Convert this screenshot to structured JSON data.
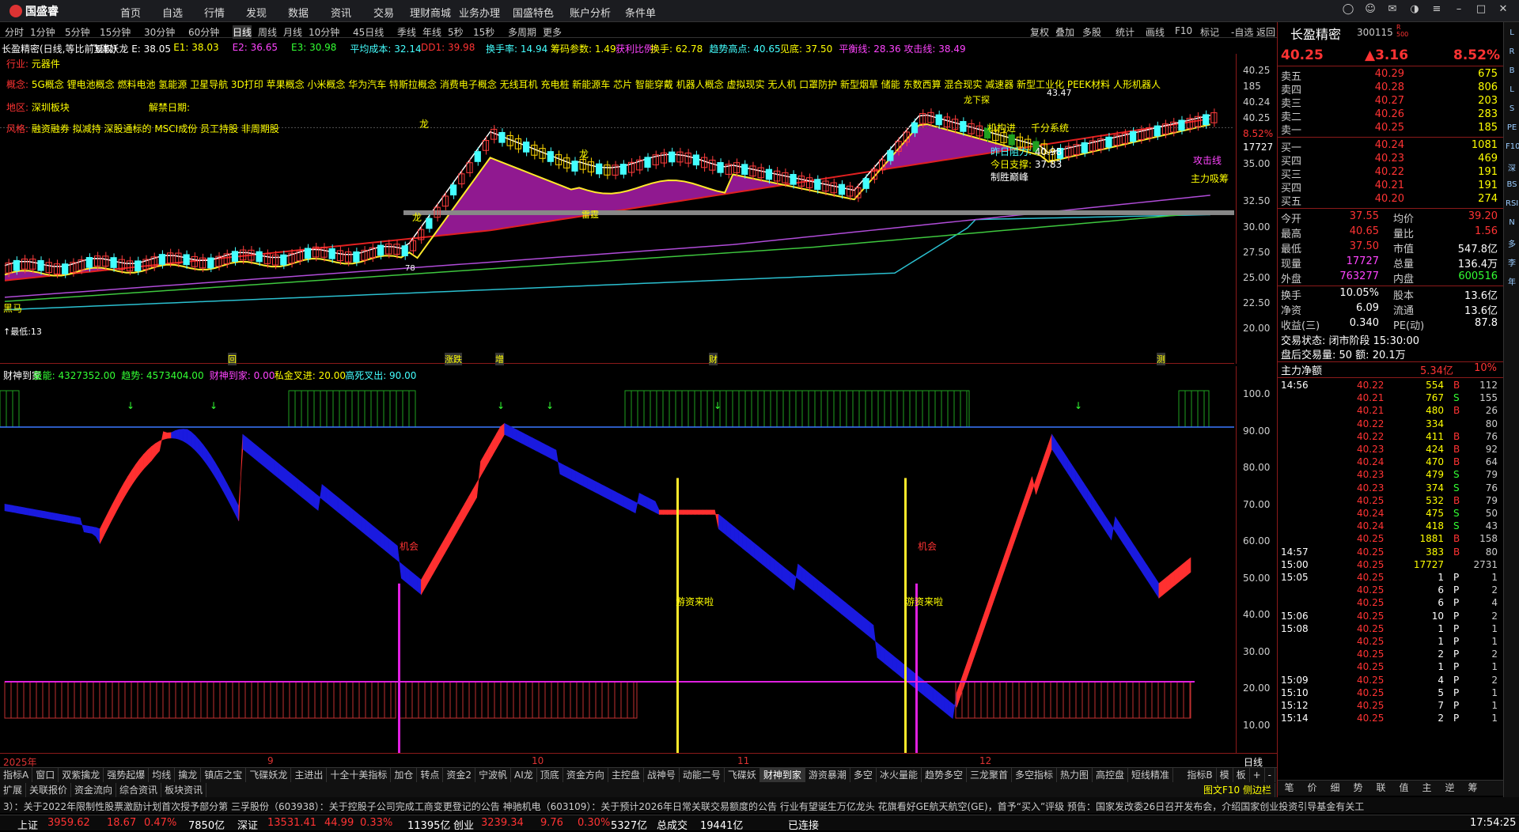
{
  "app": {
    "logo": "国盛睿",
    "menu": [
      "首页",
      "自选",
      "行情",
      "发现",
      "数据",
      "资讯",
      "交易",
      "理财商城",
      "业务办理",
      "国盛特色",
      "账户分析",
      "条件单"
    ]
  },
  "periods": [
    "分时",
    "1分钟",
    "5分钟",
    "15分钟",
    "30分钟",
    "60分钟",
    "日线",
    "周线",
    "月线",
    "10分钟",
    "45日线",
    "季线",
    "年线",
    "5秒",
    "15秒",
    "多周期",
    "更多"
  ],
  "active_period": "日线",
  "toolbar": [
    "复权",
    "叠加",
    "多股",
    "统计",
    "画线",
    "F10",
    "标记",
    "-自选",
    "返回"
  ],
  "info_line": [
    {
      "t": "长盈精密(日线,等比前复权)",
      "c": "#fff"
    },
    {
      "t": "飞碟妖龙 E: 38.05",
      "c": "#fff"
    },
    {
      "t": "E1: 38.03",
      "c": "#ff0"
    },
    {
      "t": "E2: 36.65",
      "c": "#f4f"
    },
    {
      "t": "E3: 30.98",
      "c": "#3f3"
    },
    {
      "t": "平均成本: 32.14",
      "c": "#4ff"
    },
    {
      "t": "DD1: 39.98",
      "c": "#f33"
    },
    {
      "t": "换手率: 14.94",
      "c": "#4ff"
    },
    {
      "t": "筹码参数: 1.49",
      "c": "#ff0"
    },
    {
      "t": "获利比例:",
      "c": "#f4f"
    },
    {
      "t": "换手: 62.78",
      "c": "#ff0"
    },
    {
      "t": "趋势高点: 40.65",
      "c": "#4ff"
    },
    {
      "t": "见底: 37.50",
      "c": "#ff0"
    },
    {
      "t": "平衡线: 28.36",
      "c": "#f4f"
    },
    {
      "t": "攻击线: 38.49",
      "c": "#f4f"
    }
  ],
  "stock_info": {
    "industry_label": "行业:",
    "industry": "元器件",
    "concept_label": "概念:",
    "concepts": "5G概念 锂电池概念 燃料电池 氢能源 卫星导航 3D打印 苹果概念 小米概念 华为汽车 特斯拉概念 消费电子概念 无线耳机 充电桩 新能源车 芯片 智能穿戴 机器人概念 虚拟现实 无人机 口罩防护 新型烟草 储能 东数西算 混合现实 减速器 新型工业化 PEEK材料 人形机器人",
    "region_label": "地区:",
    "region": "深圳板块",
    "unlock_label": "解禁日期:",
    "style_label": "风格:",
    "styles": "融资融券 拟减持 深股通标的 MSCI成份 员工持股 非周期股"
  },
  "price_axis": [
    "40.25",
    "185",
    "40.24",
    "40.25",
    "8.52%",
    "17727",
    "35.00",
    "32.50",
    "30.00",
    "27.50",
    "25.00",
    "22.50",
    "20.00"
  ],
  "chart_labels": {
    "tag_long1": "龙",
    "tag_long2": "龙",
    "tag_long3": "龙",
    "tag_longxia": "龙下探",
    "tag_qianfen": "千分系统",
    "tag_jigou": "机构进",
    "tag_zuori": "昨日阻力:",
    "tag_zuori_v": "40.98",
    "tag_jinri": "今日支撑:",
    "tag_jinri_v": "37.83",
    "tag_gongji": "攻击线",
    "tag_zhuli": "主力吸筹",
    "tag_xiongzhong": "制胜巅峰",
    "tag_low": "↑最低:13",
    "tag_black": "黑马",
    "tag_peak": "43.47",
    "tag_leiyun": "雷霆",
    "tag_78": "78"
  },
  "ind_header": [
    {
      "t": "财神到家",
      "c": "#fff"
    },
    {
      "t": "量能: 4327352.00",
      "c": "#3f3"
    },
    {
      "t": "趋势: 4573404.00",
      "c": "#3f3"
    },
    {
      "t": "财神到家: 0.00",
      "c": "#f4f"
    },
    {
      "t": "私金叉进: 20.00",
      "c": "#ff0"
    },
    {
      "t": "高死叉出: 90.00",
      "c": "#4ff"
    }
  ],
  "ind_axis": [
    "100.0",
    "90.00",
    "80.00",
    "70.00",
    "60.00",
    "50.00",
    "40.00",
    "30.00",
    "20.00",
    "10.00"
  ],
  "ind_labels": {
    "chance1": "机会",
    "chance2": "机会",
    "money1": "游资来啦",
    "money2": "游资来啦"
  },
  "dates": [
    "2025年",
    "9",
    "10",
    "11",
    "12"
  ],
  "date_axis_right": "日线",
  "events": [
    "回",
    "涨跌",
    "增",
    "财",
    "测"
  ],
  "tabs": [
    "指标A",
    "窗口",
    "双紫擒龙",
    "强势起爆",
    "均线",
    "擒龙",
    "镇店之宝",
    "飞碟妖龙",
    "主进出",
    "十全十美指标",
    "加仓",
    "转点",
    "资金2",
    "宁波帆",
    "AI龙",
    "顶底",
    "资金方向",
    "主控盘",
    "战神号",
    "动能二号",
    "飞碟妖",
    "财神到家",
    "游资暴潮",
    "多空",
    "冰火量能",
    "趋势多空",
    "三龙聚首",
    "多空指标",
    "热力图",
    "高控盘",
    "短线精准"
  ],
  "active_tab": "财神到家",
  "tabs_right": [
    "指标B",
    "模",
    "板",
    "+",
    "-"
  ],
  "tabs2": [
    "扩展",
    "关联报价",
    "资金流向",
    "综合资讯",
    "板块资讯"
  ],
  "tabs2_right": "图文F10 侧边栏",
  "ticker": "3）：关于2022年限制性股票激励计划首次授予部分第    三孚股份（603938）：关于控股子公司完成工商变更登记的公告    神驰机电（603109）：关于预计2026年日常关联交易额度的公告    行业有望诞生万亿龙头 花旗看好GE航天航空(GE)，首予“买入”评级    预告：国家发改委26日召开发布会，介绍国家创业投资引导基金有关工",
  "status": [
    {
      "t": "上证",
      "c": "#fff"
    },
    {
      "t": "3959.62",
      "c": "#f33"
    },
    {
      "t": "18.67",
      "c": "#f33"
    },
    {
      "t": "0.47%",
      "c": "#f33"
    },
    {
      "t": "7850亿",
      "c": "#fff"
    },
    {
      "t": "深证",
      "c": "#fff"
    },
    {
      "t": "13531.41",
      "c": "#f33"
    },
    {
      "t": "44.99",
      "c": "#f33"
    },
    {
      "t": "0.33%",
      "c": "#f33"
    },
    {
      "t": "11395亿",
      "c": "#fff"
    },
    {
      "t": "创业",
      "c": "#fff"
    },
    {
      "t": "3239.34",
      "c": "#f33"
    },
    {
      "t": "9.76",
      "c": "#f33"
    },
    {
      "t": "0.30%",
      "c": "#f33"
    },
    {
      "t": "5327亿",
      "c": "#fff"
    },
    {
      "t": "总成交",
      "c": "#fff"
    },
    {
      "t": "19441亿",
      "c": "#fff"
    },
    {
      "t": "已连接",
      "c": "#fff"
    },
    {
      "t": "17:54:25",
      "c": "#fff"
    }
  ],
  "quote": {
    "name": "长盈精密",
    "code": "300115",
    "badge": "R\n500",
    "price": "40.25",
    "change": "▲3.16",
    "pct": "8.52%",
    "asks": [
      [
        "卖五",
        "40.29",
        "675"
      ],
      [
        "卖四",
        "40.28",
        "806"
      ],
      [
        "卖三",
        "40.27",
        "203"
      ],
      [
        "卖二",
        "40.26",
        "283"
      ],
      [
        "卖一",
        "40.25",
        "185"
      ]
    ],
    "bids": [
      [
        "买一",
        "40.24",
        "1081"
      ],
      [
        "买四",
        "40.23",
        "469"
      ],
      [
        "买三",
        "40.22",
        "191"
      ],
      [
        "买四",
        "40.21",
        "191"
      ],
      [
        "买五",
        "40.20",
        "274"
      ]
    ],
    "stats": [
      [
        "今开",
        "37.55",
        "均价",
        "39.20"
      ],
      [
        "最高",
        "40.65",
        "量比",
        "1.56"
      ],
      [
        "最低",
        "37.50",
        "市值",
        "547.8亿"
      ],
      [
        "现量",
        "17727",
        "总量",
        "136.4万"
      ],
      [
        "外盘",
        "763277",
        "内盘",
        "600516"
      ],
      [
        "换手",
        "10.05%",
        "股本",
        "13.6亿"
      ],
      [
        "净资",
        "6.09",
        "流通",
        "13.6亿"
      ],
      [
        "收益(三)",
        "0.340",
        "PE(动)",
        "87.8"
      ]
    ],
    "trade_state": "交易状态: 闭市阶段 15:30:00",
    "after_hours": "盘后交易量: 50  额: 20.1万",
    "main_flow_label": "主力净额",
    "main_flow": "5.34亿",
    "main_flow_pct": "10%",
    "ticks": [
      [
        "14:56",
        "40.22",
        "554",
        "B",
        "112"
      ],
      [
        "",
        "40.21",
        "767",
        "S",
        "155"
      ],
      [
        "",
        "40.21",
        "480",
        "B",
        "26"
      ],
      [
        "",
        "40.22",
        "334",
        "",
        "80"
      ],
      [
        "",
        "40.22",
        "411",
        "B",
        "76"
      ],
      [
        "",
        "40.23",
        "424",
        "B",
        "92"
      ],
      [
        "",
        "40.24",
        "470",
        "B",
        "64"
      ],
      [
        "",
        "40.23",
        "479",
        "S",
        "79"
      ],
      [
        "",
        "40.23",
        "374",
        "S",
        "76"
      ],
      [
        "",
        "40.25",
        "532",
        "B",
        "79"
      ],
      [
        "",
        "40.24",
        "475",
        "S",
        "50"
      ],
      [
        "",
        "40.24",
        "418",
        "S",
        "43"
      ],
      [
        "",
        "40.25",
        "1881",
        "B",
        "158"
      ],
      [
        "14:57",
        "40.25",
        "383",
        "B",
        "80"
      ],
      [
        "15:00",
        "40.25",
        "17727",
        "",
        "2731"
      ],
      [
        "15:05",
        "40.25",
        "1",
        "P",
        "1"
      ],
      [
        "",
        "40.25",
        "6",
        "P",
        "2"
      ],
      [
        "",
        "40.25",
        "6",
        "P",
        "4"
      ],
      [
        "15:06",
        "40.25",
        "10",
        "P",
        "2"
      ],
      [
        "15:08",
        "40.25",
        "1",
        "P",
        "1"
      ],
      [
        "",
        "40.25",
        "1",
        "P",
        "1"
      ],
      [
        "",
        "40.25",
        "2",
        "P",
        "2"
      ],
      [
        "",
        "40.25",
        "1",
        "P",
        "1"
      ],
      [
        "15:09",
        "40.25",
        "4",
        "P",
        "2"
      ],
      [
        "15:10",
        "40.25",
        "5",
        "P",
        "1"
      ],
      [
        "15:12",
        "40.25",
        "7",
        "P",
        "1"
      ],
      [
        "15:14",
        "40.25",
        "2",
        "P",
        "1"
      ]
    ],
    "bottom_tabs": [
      "笔",
      "价",
      "细",
      "势",
      "联",
      "值",
      "主",
      "逆",
      "筹"
    ]
  },
  "sidebar_icons": [
    "L",
    "R",
    "B",
    "L",
    "S",
    "PE",
    "F10",
    "深",
    "BS",
    "RSI",
    "N",
    "多",
    "李",
    "年"
  ]
}
